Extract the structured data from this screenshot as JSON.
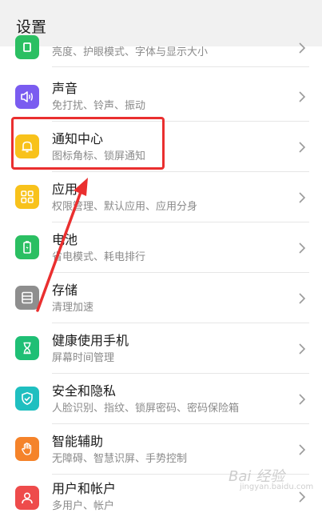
{
  "header": {
    "title": "设置"
  },
  "items": [
    {
      "label": "",
      "sub": "亮度、护眼模式、字体与显示大小",
      "icon": "display-icon",
      "color": "#2bbf62"
    },
    {
      "label": "声音",
      "sub": "免打扰、铃声、振动",
      "icon": "speaker-icon",
      "color": "#7a5cf0"
    },
    {
      "label": "通知中心",
      "sub": "图标角标、锁屏通知",
      "icon": "bell-icon",
      "color": "#f8c21b"
    },
    {
      "label": "应用",
      "sub": "权限管理、默认应用、应用分身",
      "icon": "apps-grid-icon",
      "color": "#f8c21b"
    },
    {
      "label": "电池",
      "sub": "省电模式、耗电排行",
      "icon": "battery-icon",
      "color": "#2bbf62"
    },
    {
      "label": "存储",
      "sub": "清理加速",
      "icon": "storage-icon",
      "color": "#8e8e8e"
    },
    {
      "label": "健康使用手机",
      "sub": "屏幕时间管理",
      "icon": "hourglass-icon",
      "color": "#1fbf75"
    },
    {
      "label": "安全和隐私",
      "sub": "人脸识别、指纹、锁屏密码、密码保险箱",
      "icon": "shield-icon",
      "color": "#1fbfc0"
    },
    {
      "label": "智能辅助",
      "sub": "无障碍、智慧识屏、手势控制",
      "icon": "hand-icon",
      "color": "#f5832a"
    },
    {
      "label": "用户和帐户",
      "sub": "多用户、帐户",
      "icon": "user-icon",
      "color": "#ee4b4b"
    }
  ],
  "annotation": {
    "color": "#ea2f2f"
  },
  "watermark": {
    "text": "Bai 经验",
    "sub": "jingyan.baidu.com"
  }
}
